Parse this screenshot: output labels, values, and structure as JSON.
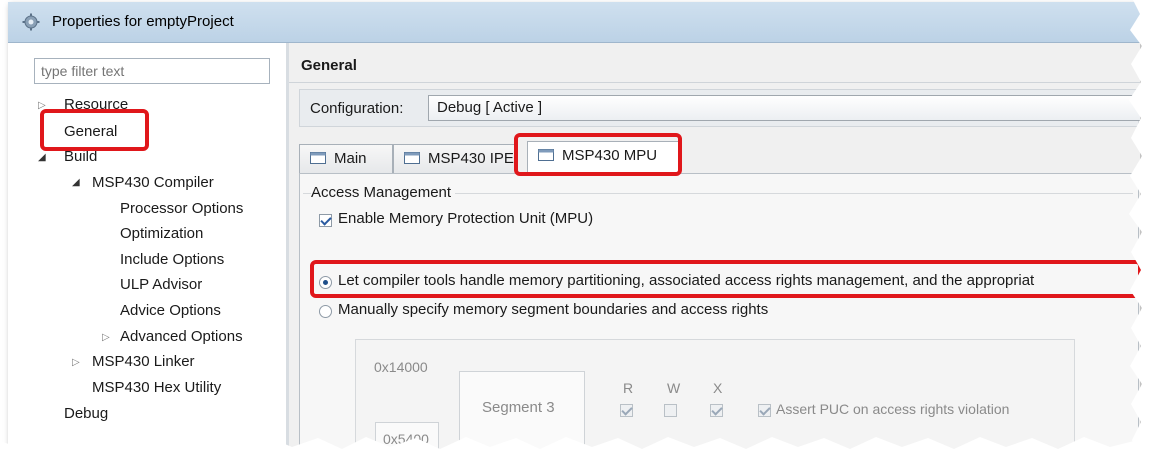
{
  "window": {
    "title": "Properties for emptyProject"
  },
  "filter": {
    "placeholder": "type filter text"
  },
  "tree": {
    "resource": "Resource",
    "general": "General",
    "build": "Build",
    "compiler": "MSP430 Compiler",
    "processor_options": "Processor Options",
    "optimization": "Optimization",
    "include_options": "Include Options",
    "ulp_advisor": "ULP Advisor",
    "advice_options": "Advice Options",
    "advanced_options": "Advanced Options",
    "linker": "MSP430 Linker",
    "hex_utility": "MSP430 Hex Utility",
    "debug": "Debug"
  },
  "page": {
    "title": "General"
  },
  "configuration": {
    "label": "Configuration:",
    "value": "Debug  [ Active ]"
  },
  "tabs": [
    {
      "label": "Main"
    },
    {
      "label": "MSP430 IPE"
    },
    {
      "label": "MSP430 MPU"
    }
  ],
  "access": {
    "group_label": "Access Management",
    "enable_mpu_label": "Enable Memory Protection Unit (MPU)",
    "enable_mpu_checked": true,
    "auto_option": "Let compiler tools handle memory partitioning, associated access rights management, and the appropriat",
    "manual_option": "Manually specify memory segment boundaries and access rights",
    "selected_option": "auto"
  },
  "segments": {
    "addr_top": "0x14000",
    "addr_bottom": "0x5400",
    "segment_label": "Segment 3",
    "col_r": "R",
    "col_w": "W",
    "col_x": "X",
    "r_checked": true,
    "w_checked": false,
    "x_checked": true,
    "assert_puc_label": "Assert PUC on access rights violation",
    "assert_puc_checked": true
  },
  "colors": {
    "highlight": "#e0171b",
    "titlebar": "#c7dbee",
    "panel": "#f0f0f0"
  }
}
